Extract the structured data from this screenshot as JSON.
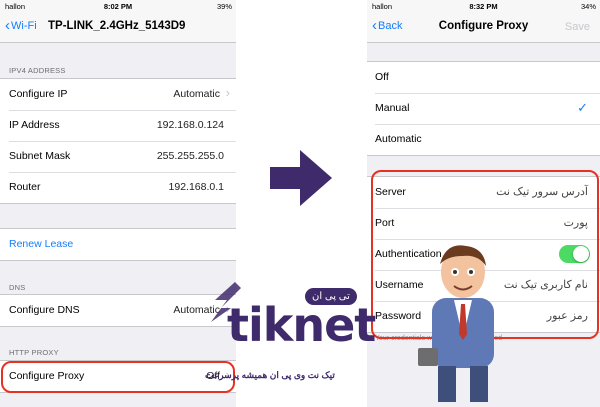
{
  "left_screen": {
    "status_bar": {
      "carrier": "hallon",
      "time": "8:02 PM",
      "battery": "39%"
    },
    "nav": {
      "back_label": "Wi-Fi",
      "title": "TP-LINK_2.4GHz_5143D9"
    },
    "ipv4": {
      "header": "IPV4 ADDRESS",
      "rows": [
        {
          "label": "Configure IP",
          "value": "Automatic"
        },
        {
          "label": "IP Address",
          "value": "192.168.0.124"
        },
        {
          "label": "Subnet Mask",
          "value": "255.255.255.0"
        },
        {
          "label": "Router",
          "value": "192.168.0.1"
        }
      ]
    },
    "renew_lease": "Renew Lease",
    "dns": {
      "header": "DNS",
      "label": "Configure DNS",
      "value": "Automatic"
    },
    "http_proxy": {
      "header": "HTTP PROXY",
      "label": "Configure Proxy",
      "value": "Off"
    }
  },
  "right_screen": {
    "status_bar": {
      "carrier": "hallon",
      "time": "8:32 PM",
      "battery": "34%"
    },
    "nav": {
      "back_label": "Back",
      "title": "Configure Proxy",
      "save_label": "Save"
    },
    "modes": [
      {
        "label": "Off",
        "selected": false
      },
      {
        "label": "Manual",
        "selected": true
      },
      {
        "label": "Automatic",
        "selected": false
      }
    ],
    "fields": {
      "server": {
        "label": "Server",
        "value": "آدرس سرور تیک نت"
      },
      "port": {
        "label": "Port",
        "value": "پورت"
      },
      "authentication": {
        "label": "Authentication",
        "enabled": true
      },
      "username": {
        "label": "Username",
        "value": "نام کاربری تیک نت"
      },
      "password": {
        "label": "Password",
        "value": "رمز عبور"
      }
    },
    "footnote": "Your credentials will be sent unencrypted"
  },
  "branding": {
    "logo": "tiknet",
    "bubble": "تی پی ان",
    "tagline": "تیک نت وی پی ان همیشه پرسرعت"
  },
  "colors": {
    "accent_blue": "#157efb",
    "toggle_green": "#4cd964",
    "highlight_red": "#e53223",
    "arrow_purple": "#3f2a6b"
  }
}
